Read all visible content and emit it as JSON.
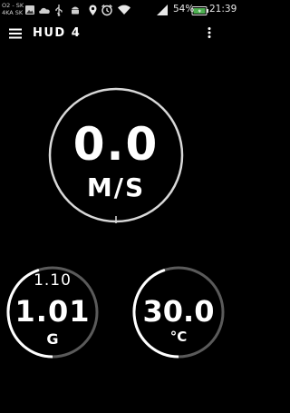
{
  "status_bar": {
    "carrier_line1": "O2 - SK",
    "carrier_line2": "4KA SK",
    "battery_percent": "54%",
    "time": "21:39",
    "icons": [
      "image-icon",
      "cloud-icon",
      "usb-icon",
      "android-icon",
      "location-pin-icon",
      "alarm-icon",
      "wifi-icon",
      "signal-icon",
      "battery-icon"
    ]
  },
  "app_bar": {
    "title": "HUD 4",
    "menu_icon": "hamburger-menu-icon",
    "overflow_icon": "more-vert-icon"
  },
  "speed_gauge": {
    "value": "0.0",
    "unit": "M/S"
  },
  "g_gauge": {
    "peak": "1.10",
    "value": "1.01",
    "unit": "G",
    "fill_fraction": 0.45
  },
  "temp_gauge": {
    "value": "30.0",
    "unit": "°C",
    "fill_fraction": 0.45
  },
  "colors": {
    "background": "#000000",
    "text": "#ffffff",
    "gauge_ring": "#ffffff",
    "gauge_track": "#5a5a5a",
    "battery_fill": "#4caf50"
  }
}
